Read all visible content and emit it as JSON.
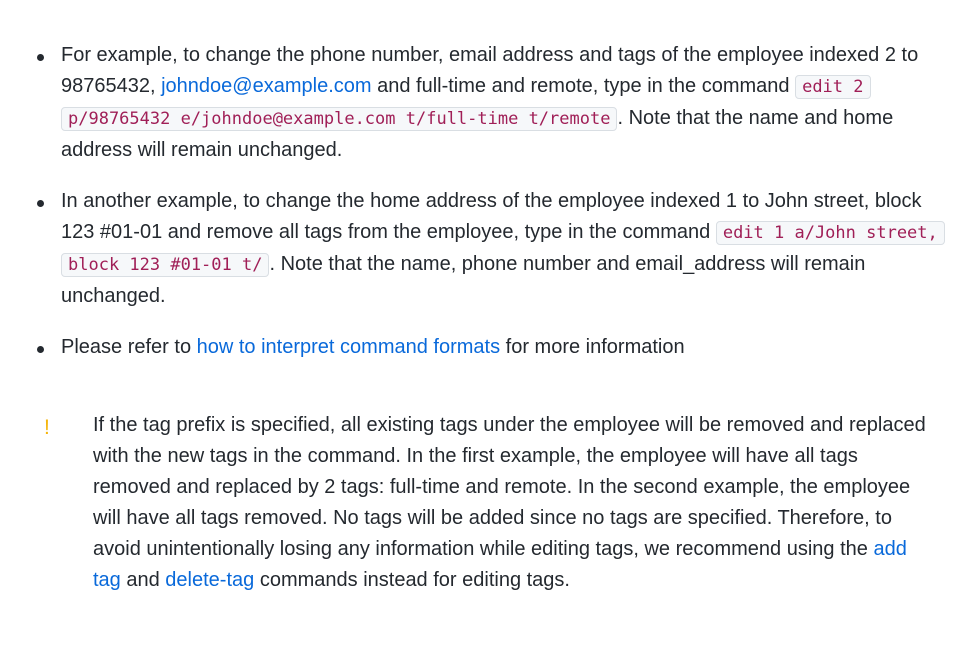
{
  "bullets": [
    {
      "t1": "For example, to change the phone number, email address and tags of the employee indexed 2 to 98765432, ",
      "link": "johndoe@example.com",
      "t2": " and full-time and remote, type in the command ",
      "code": "edit 2 p/98765432 e/johndoe@example.com t/full-time t/remote",
      "t3": ". Note that the name and home address will remain unchanged."
    },
    {
      "t1": "In another example, to change the home address of the employee indexed 1 to John street, block 123 #01-01 and remove all tags from the employee, type in the command ",
      "code": "edit 1 a/John street, block 123 #01-01 t/",
      "t2": ". Note that the name, phone number and email_address will remain unchanged."
    },
    {
      "t1": "Please refer to ",
      "link": "how to interpret command formats",
      "t2": " for more information"
    }
  ],
  "note": {
    "icon": "!",
    "icon_name": "exclamation-icon",
    "icon_color": "#f5b50a",
    "t1": "If the tag prefix is specified, all existing tags under the employee will be removed and replaced with the new tags in the command. In the first example, the employee will have all tags removed and replaced by 2 tags: full-time and remote. In the second example, the employee will have all tags removed. No tags will be added since no tags are specified. Therefore, to avoid unintentionally losing any information while editing tags, we recommend using the ",
    "link1": "add tag",
    "t2": " and ",
    "link2": "delete-tag",
    "t3": " commands instead for editing tags."
  },
  "colors": {
    "text": "#24292f",
    "link": "#0969da",
    "code_text": "#a01f57",
    "code_bg": "#f6f8fa"
  }
}
